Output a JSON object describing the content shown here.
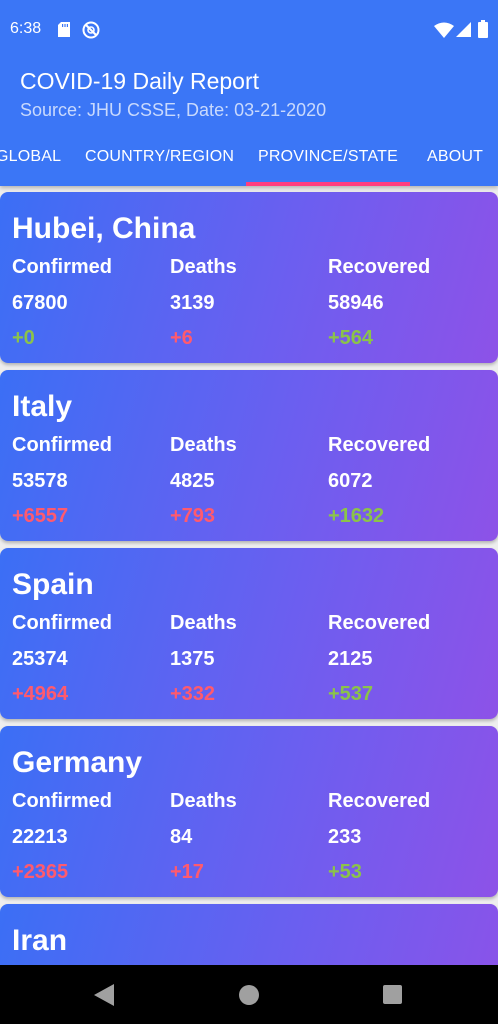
{
  "status_bar": {
    "time": "6:38",
    "icons": [
      "sd-card-icon",
      "do-not-disturb-icon",
      "wifi-icon",
      "cell-signal-icon",
      "battery-icon"
    ]
  },
  "app_bar": {
    "title": "COVID-19 Daily Report",
    "subtitle": "Source: JHU CSSE, Date: 03-21-2020",
    "background": "#3b76f6"
  },
  "tabs": [
    {
      "label": "GLOBAL"
    },
    {
      "label": "COUNTRY/REGION"
    },
    {
      "label": "PROVINCE/STATE",
      "selected": true
    },
    {
      "label": "ABOUT"
    }
  ],
  "column_labels": {
    "confirmed": "Confirmed",
    "deaths": "Deaths",
    "recovered": "Recovered"
  },
  "colors": {
    "increase_bad": "#ff5a6e",
    "increase_good": "#8bc34a",
    "tab_indicator": "#ff3d7f"
  },
  "regions": [
    {
      "name": "Hubei, China",
      "confirmed": "67800",
      "deaths": "3139",
      "recovered": "58946",
      "confirmed_delta": "+0",
      "deaths_delta": "+6",
      "recovered_delta": "+564"
    },
    {
      "name": "Italy",
      "confirmed": "53578",
      "deaths": "4825",
      "recovered": "6072",
      "confirmed_delta": "+6557",
      "deaths_delta": "+793",
      "recovered_delta": "+1632"
    },
    {
      "name": "Spain",
      "confirmed": "25374",
      "deaths": "1375",
      "recovered": "2125",
      "confirmed_delta": "+4964",
      "deaths_delta": "+332",
      "recovered_delta": "+537"
    },
    {
      "name": "Germany",
      "confirmed": "22213",
      "deaths": "84",
      "recovered": "233",
      "confirmed_delta": "+2365",
      "deaths_delta": "+17",
      "recovered_delta": "+53"
    },
    {
      "name": "Iran",
      "confirmed": "",
      "deaths": "",
      "recovered": "",
      "confirmed_delta": "",
      "deaths_delta": "",
      "recovered_delta": ""
    }
  ],
  "nav_bar": {
    "buttons": [
      "back-icon",
      "home-icon",
      "recents-icon"
    ]
  }
}
